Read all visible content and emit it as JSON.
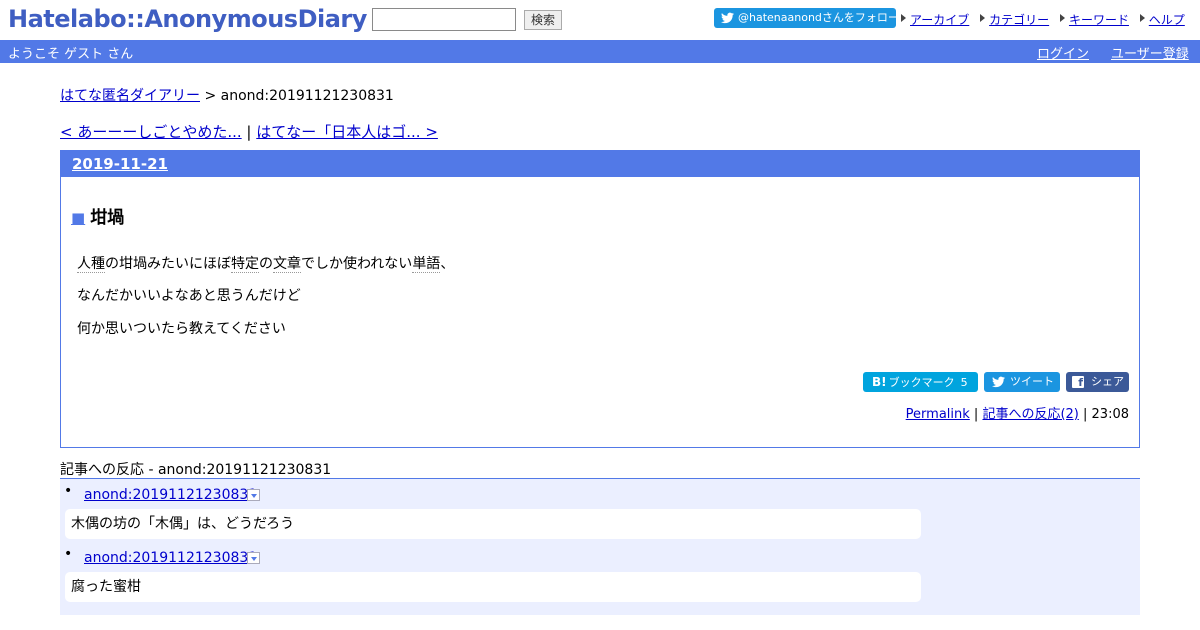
{
  "header": {
    "logo": "Hatelabo::AnonymousDiary",
    "search_button": "検索",
    "search_value": "",
    "follow_label": "@hatenaanondさんをフォロー",
    "top_links": [
      "アーカイブ",
      "カテゴリー",
      "キーワード",
      "ヘルプ"
    ]
  },
  "bar": {
    "welcome": "ようこそ ゲスト さん",
    "login": "ログイン",
    "register": "ユーザー登録"
  },
  "breadcrumb": {
    "home": "はてな匿名ダイアリー",
    "separator": " > ",
    "current": "anond:20191121230831"
  },
  "nav": {
    "prev": "< あーーーしごとやめた...",
    "separator": " | ",
    "next": "はてなー「日本人はゴ... >"
  },
  "day": {
    "date": "2019-11-21",
    "entry": {
      "square": "■",
      "title": "坩堝",
      "kw1": "人種",
      "p1_mid": "の坩堝みたいにほぼ",
      "kw2": "特定",
      "p1_mid2": "の",
      "kw3": "文章",
      "p1_mid3": "でしか使われない",
      "kw4": "単語",
      "p1_end": "、",
      "p2": "なんだかいいよなあと思うんだけど",
      "p3": "何か思いついたら教えてください"
    },
    "social": {
      "hatena_logo": "B!",
      "hatena_label": "ブックマーク",
      "hatena_count": "5",
      "tweet": "ツイート",
      "share": "シェア",
      "fb_letter": "f"
    },
    "footer": {
      "permalink": "Permalink",
      "sep1": " | ",
      "reactions": "記事への反応(2)",
      "sep2": " | ",
      "time": "23:08"
    }
  },
  "reactions": {
    "title": "記事への反応 - anond:20191121230831",
    "items": [
      {
        "bullet": "•",
        "link": "anond:20191121230831",
        "body": "木偶の坊の「木偶」は、どうだろう"
      },
      {
        "bullet": "•",
        "link": "anond:20191121230831",
        "body": "腐った蜜柑"
      }
    ]
  },
  "colors": {
    "accent": "#5279e7",
    "logo": "#3f5ec2",
    "twitter": "#1b95e0",
    "hatena": "#00a4de",
    "facebook": "#3b5998",
    "reaction_bg": "#ebefff"
  }
}
